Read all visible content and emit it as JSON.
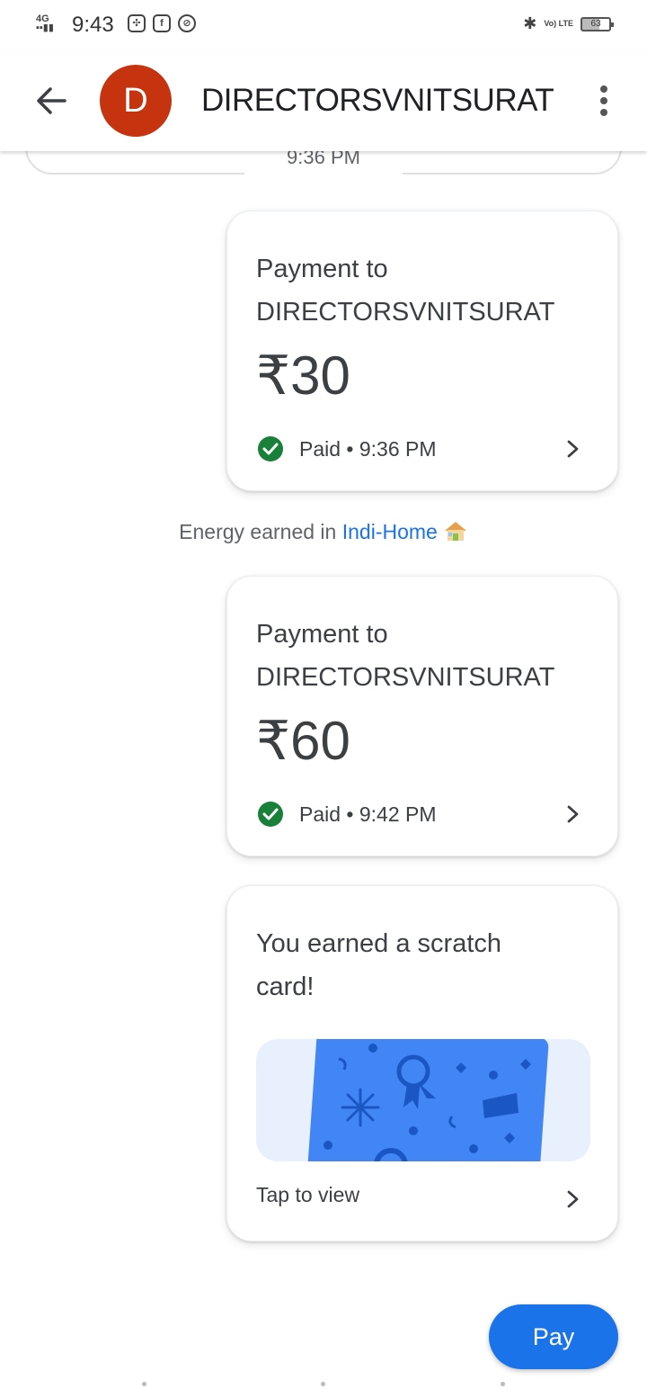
{
  "status_bar": {
    "network": "4G",
    "time": "9:43",
    "volte": "Vo) LTE",
    "battery": "63"
  },
  "header": {
    "avatar_letter": "D",
    "title": "DIRECTORSVNITSURAT"
  },
  "previous_message": {
    "time": "9:36 PM"
  },
  "payments": [
    {
      "heading_line1": "Payment to",
      "heading_line2": "DIRECTORSVNITSURAT",
      "amount": "₹30",
      "status": "Paid • 9:36 PM"
    },
    {
      "heading_line1": "Payment to",
      "heading_line2": "DIRECTORSVNITSURAT",
      "amount": "₹60",
      "status": "Paid • 9:42 PM"
    }
  ],
  "energy_note": {
    "prefix": "Energy earned in ",
    "link": "Indi-Home"
  },
  "scratch_card": {
    "heading_line1": "You earned a scratch",
    "heading_line2": "card!",
    "action": "Tap to view"
  },
  "pay_button": {
    "label": "Pay"
  },
  "colors": {
    "avatar": "#c5340e",
    "paid_check": "#188038",
    "accent": "#1a73e8",
    "scratch_card": "#4285f4"
  }
}
